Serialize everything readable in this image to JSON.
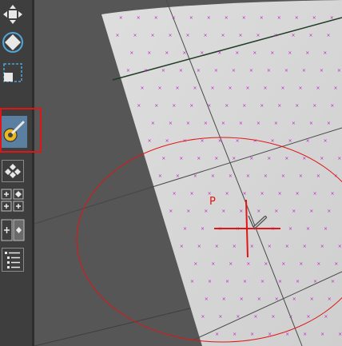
{
  "toolbar": {
    "tools": [
      {
        "name": "move-tool",
        "icon": "move-icon"
      },
      {
        "name": "rotate-tool",
        "icon": "rotate-icon"
      },
      {
        "name": "scale-tool",
        "icon": "scale-icon"
      },
      {
        "name": "paint-tool",
        "icon": "paint-brush-icon",
        "active": true
      },
      {
        "name": "snap-tool",
        "icon": "snap-grid-icon"
      },
      {
        "name": "add-tool",
        "icon": "add-grid-icon"
      },
      {
        "name": "insert-tool",
        "icon": "insert-icon"
      },
      {
        "name": "list-tool",
        "icon": "list-icon"
      }
    ]
  },
  "viewport": {
    "pivot_label": "P",
    "colors": {
      "background": "#565656",
      "surface": "#d4d4d4",
      "vertex": "#c020c8",
      "brush_circle": "#e01515",
      "highlight": "#e01515"
    }
  }
}
